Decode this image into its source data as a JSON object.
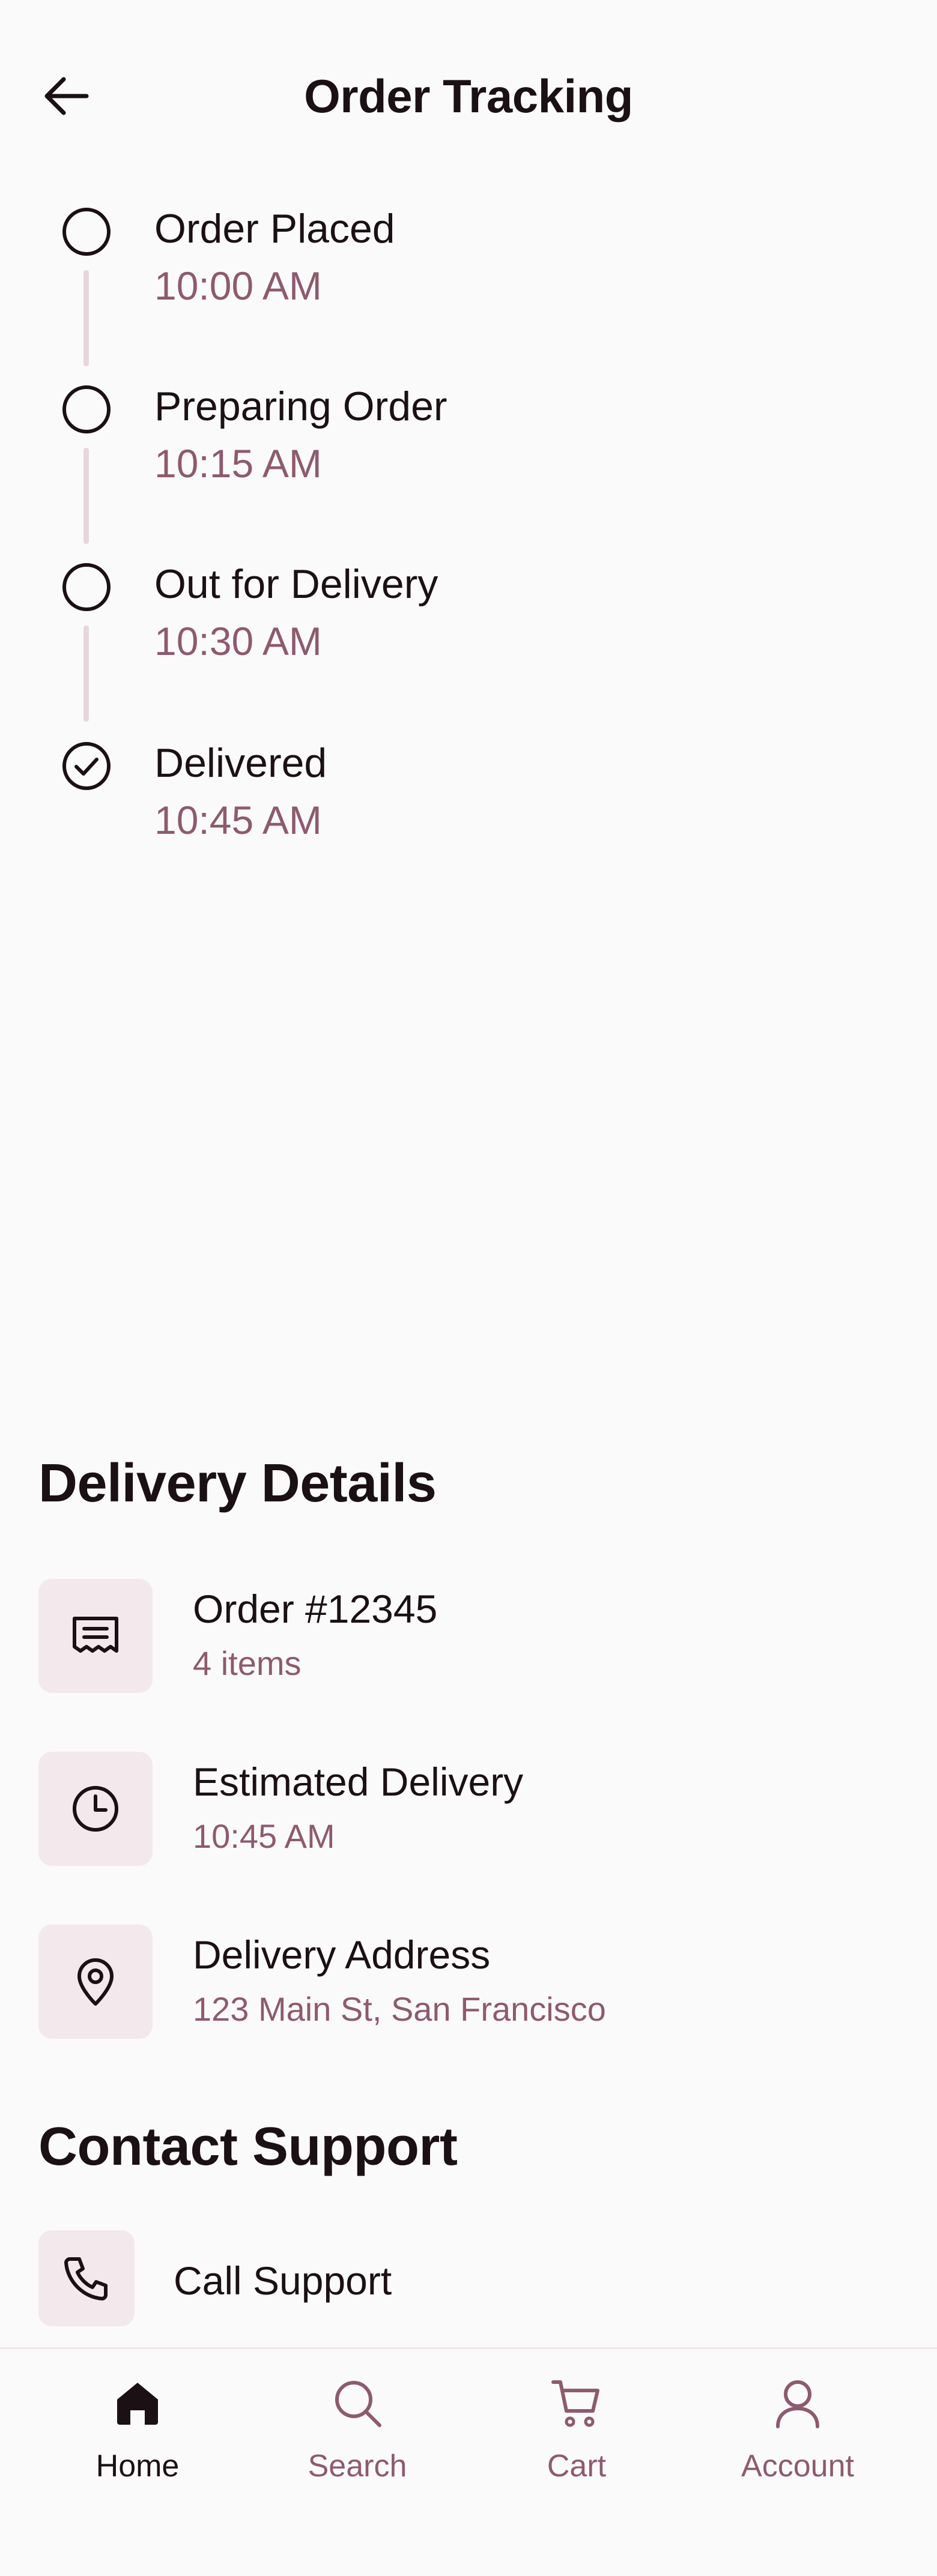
{
  "header": {
    "title": "Order Tracking",
    "back_icon": "arrow-left-icon"
  },
  "timeline": [
    {
      "label": "Order Placed",
      "time": "10:00 AM",
      "status_icon": "circle-icon"
    },
    {
      "label": "Preparing Order",
      "time": "10:15 AM",
      "status_icon": "circle-icon"
    },
    {
      "label": "Out for Delivery",
      "time": "10:30 AM",
      "status_icon": "circle-icon"
    },
    {
      "label": "Delivered",
      "time": "10:45 AM",
      "status_icon": "check-circle-icon"
    }
  ],
  "delivery_details": {
    "title": "Delivery Details",
    "items": [
      {
        "title": "Order #12345",
        "subtitle": "4 items",
        "icon": "receipt-icon"
      },
      {
        "title": "Estimated Delivery",
        "subtitle": "10:45 AM",
        "icon": "clock-icon"
      },
      {
        "title": "Delivery Address",
        "subtitle": "123 Main St, San Francisco",
        "icon": "location-pin-icon"
      }
    ]
  },
  "contact_support": {
    "title": "Contact Support",
    "items": [
      {
        "label": "Call Support",
        "icon": "phone-icon"
      }
    ]
  },
  "bottom_nav": {
    "items": [
      {
        "label": "Home",
        "icon": "home-icon",
        "active": true
      },
      {
        "label": "Search",
        "icon": "search-icon",
        "active": false
      },
      {
        "label": "Cart",
        "icon": "cart-icon",
        "active": false
      },
      {
        "label": "Account",
        "icon": "user-icon",
        "active": false
      }
    ]
  },
  "colors": {
    "background": "#fbfafa",
    "text_primary": "#1b1014",
    "text_secondary": "#8e5a6e",
    "tile_background": "#f3e8ec",
    "timeline_line": "#e6d7dc"
  }
}
